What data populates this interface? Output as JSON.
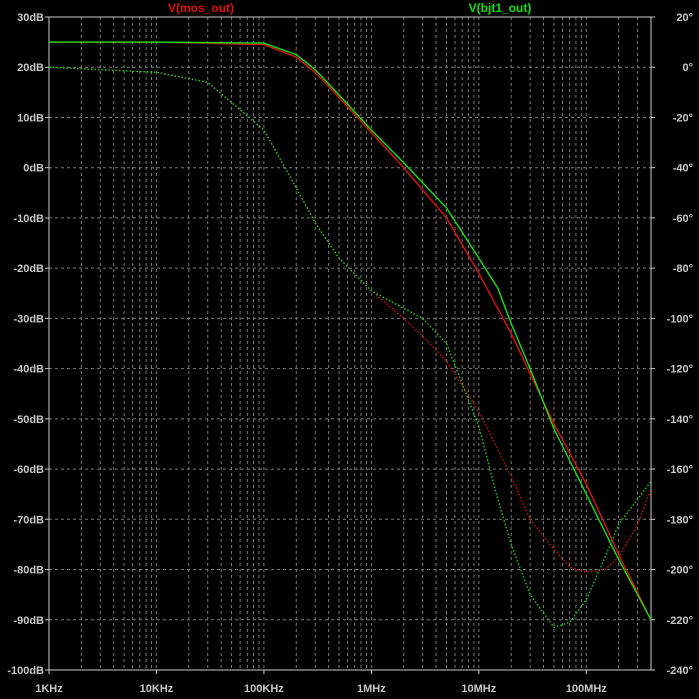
{
  "chart_data": {
    "type": "line",
    "title": "",
    "xlabel": "",
    "x_scale": "log",
    "xlim": [
      1000,
      400000000
    ],
    "y_left": {
      "unit": "dB",
      "ylim": [
        -100,
        30
      ],
      "ticks": [
        "30dB",
        "20dB",
        "10dB",
        "0dB",
        "-10dB",
        "-20dB",
        "-30dB",
        "-40dB",
        "-50dB",
        "-60dB",
        "-70dB",
        "-80dB",
        "-90dB",
        "-100dB"
      ]
    },
    "y_right": {
      "unit": "degrees",
      "ylim": [
        -240,
        20
      ],
      "ticks": [
        "20°",
        "0°",
        "-20°",
        "-40°",
        "-60°",
        "-80°",
        "-100°",
        "-120°",
        "-140°",
        "-160°",
        "-180°",
        "-200°",
        "-220°",
        "-240°"
      ]
    },
    "x_ticks": [
      {
        "label": "1KHz",
        "value": 1000
      },
      {
        "label": "10KHz",
        "value": 10000
      },
      {
        "label": "100KHz",
        "value": 100000
      },
      {
        "label": "1MHz",
        "value": 1000000
      },
      {
        "label": "10MHz",
        "value": 10000000
      },
      {
        "label": "100MHz",
        "value": 100000000
      }
    ],
    "grid": true,
    "legend_placement": "top",
    "colors": {
      "background": "#000000",
      "grid": "#7a7a7a",
      "axis": "#cccccc",
      "tick_text": "#c8c8c8"
    },
    "series": [
      {
        "name": "V(mos_out)",
        "color": "#e01010",
        "kind": "magnitude",
        "x": [
          1000,
          10000,
          100000,
          200000,
          300000,
          500000,
          1000000,
          2000000,
          5000000,
          10000000,
          20000000,
          30000000,
          50000000,
          100000000,
          200000000,
          400000000
        ],
        "y": [
          25,
          25,
          24.5,
          22,
          19,
          14,
          7,
          0,
          -10,
          -21,
          -33,
          -41,
          -51,
          -63,
          -77,
          -90
        ]
      },
      {
        "name": "V(mos_out)",
        "color": "#e01010",
        "kind": "phase",
        "x": [
          1000,
          10000,
          30000,
          100000,
          200000,
          300000,
          500000,
          1000000,
          2000000,
          3000000,
          5000000,
          10000000,
          20000000,
          30000000,
          50000000,
          70000000,
          100000000,
          150000000,
          200000000,
          300000000,
          400000000
        ],
        "y": [
          0,
          -2,
          -6,
          -25,
          -48,
          -62,
          -76,
          -89,
          -100,
          -107,
          -117,
          -137,
          -163,
          -180,
          -192,
          -199,
          -201,
          -200,
          -195,
          -182,
          -168
        ]
      },
      {
        "name": "V(bjt1_out)",
        "color": "#10e010",
        "kind": "magnitude",
        "x": [
          1000,
          10000,
          100000,
          200000,
          300000,
          500000,
          1000000,
          2000000,
          5000000,
          10000000,
          15000000,
          20000000,
          30000000,
          50000000,
          100000000,
          200000000,
          400000000
        ],
        "y": [
          25,
          25,
          24.8,
          22.5,
          19.5,
          14.5,
          7.5,
          1,
          -8,
          -18,
          -24,
          -31,
          -40,
          -52,
          -65,
          -78,
          -90
        ]
      },
      {
        "name": "V(bjt1_out)",
        "color": "#10e010",
        "kind": "phase",
        "x": [
          1000,
          10000,
          30000,
          100000,
          200000,
          300000,
          500000,
          1000000,
          2000000,
          3000000,
          5000000,
          10000000,
          15000000,
          20000000,
          30000000,
          50000000,
          70000000,
          100000000,
          150000000,
          200000000,
          300000000,
          400000000
        ],
        "y": [
          0,
          -2,
          -6,
          -25,
          -48,
          -62,
          -76,
          -89,
          -96,
          -100,
          -110,
          -143,
          -172,
          -190,
          -210,
          -223,
          -221,
          -212,
          -195,
          -182,
          -172,
          -165
        ]
      }
    ]
  }
}
